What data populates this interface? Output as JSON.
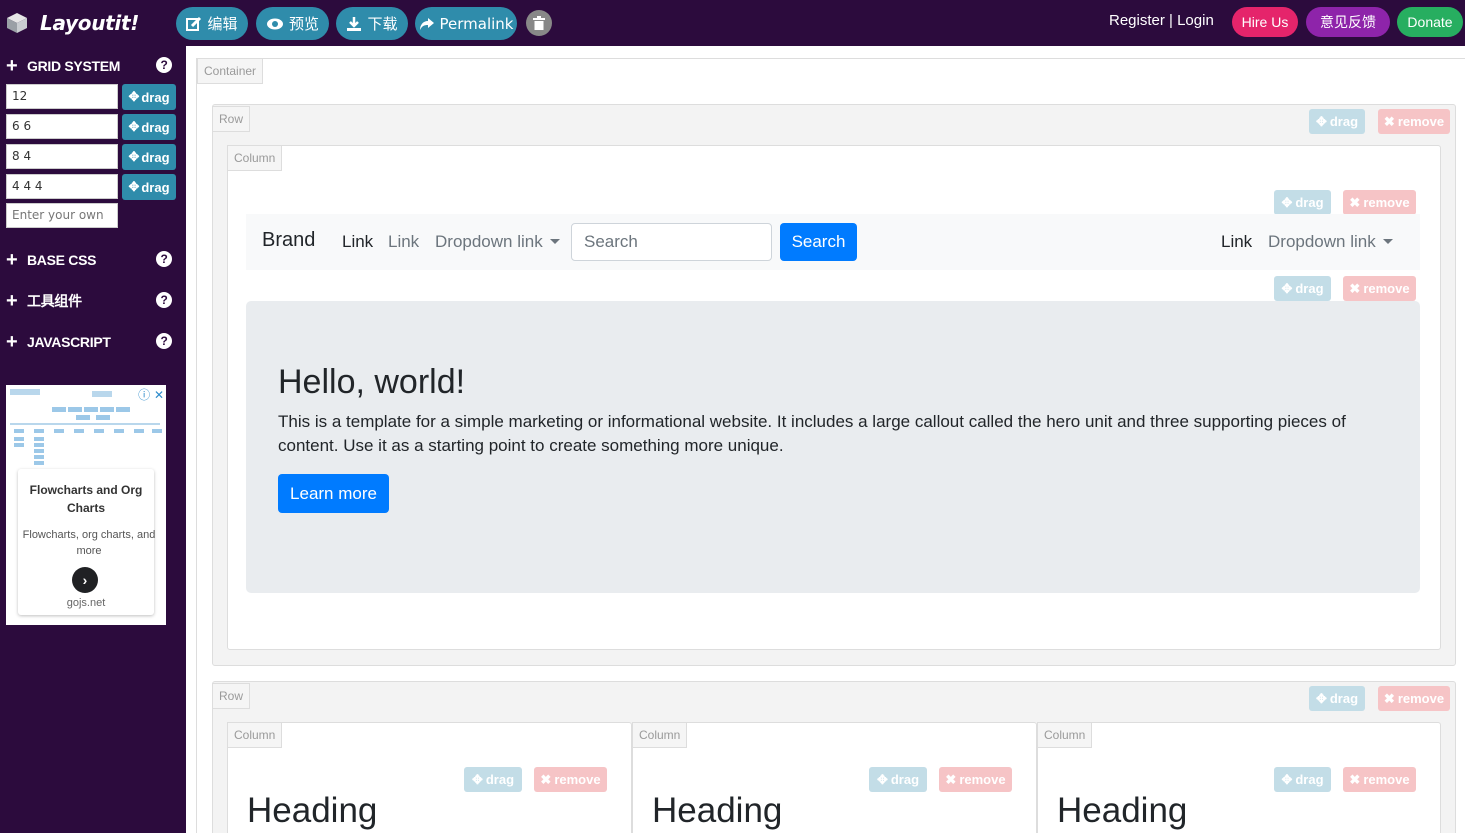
{
  "app": {
    "logo_text": "Layoutit!"
  },
  "toolbar": {
    "edit_label": "编辑",
    "preview_label": "预览",
    "download_label": "下载",
    "permalink_label": "Permalink"
  },
  "auth": {
    "register": "Register",
    "separator": " | ",
    "login": "Login"
  },
  "top_actions": {
    "hire_us": "Hire Us",
    "feedback": "意见反馈",
    "donate": "Donate"
  },
  "colors": {
    "nav_bg": "#2c0b3d",
    "accent": "#2f8cab",
    "hire": "#e5246b",
    "feedback": "#8e24aa",
    "donate": "#27ae60",
    "primary": "#007bff"
  },
  "sidebar": {
    "sections": [
      {
        "label": "GRID SYSTEM",
        "help": "?"
      },
      {
        "label": "BASE CSS",
        "help": "?"
      },
      {
        "label": "工具组件",
        "help": "?"
      },
      {
        "label": "JAVASCRIPT",
        "help": "?"
      }
    ],
    "grid_rows": [
      {
        "value": "12",
        "drag_label": "drag"
      },
      {
        "value": "6 6",
        "drag_label": "drag"
      },
      {
        "value": "8 4",
        "drag_label": "drag"
      },
      {
        "value": "4 4 4",
        "drag_label": "drag"
      }
    ],
    "custom_placeholder": "Enter your own"
  },
  "ad": {
    "title": "Flowcharts and Org Charts",
    "description": "Flowcharts, org charts, and more",
    "url": "gojs.net"
  },
  "canvas": {
    "container_label": "Container",
    "row_label": "Row",
    "column_label": "Column",
    "drag_label": "drag",
    "remove_label": "remove"
  },
  "navbar": {
    "brand": "Brand",
    "link_active": "Link",
    "link": "Link",
    "dropdown": "Dropdown link",
    "search_placeholder": "Search",
    "search_button": "Search",
    "right_link": "Link",
    "right_dropdown": "Dropdown link"
  },
  "hero": {
    "title": "Hello, world!",
    "text": "This is a template for a simple marketing or informational website. It includes a large callout called the hero unit and three supporting pieces of content. Use it as a starting point to create something more unique.",
    "button": "Learn more"
  },
  "columns": [
    {
      "heading": "Heading"
    },
    {
      "heading": "Heading"
    },
    {
      "heading": "Heading"
    }
  ]
}
